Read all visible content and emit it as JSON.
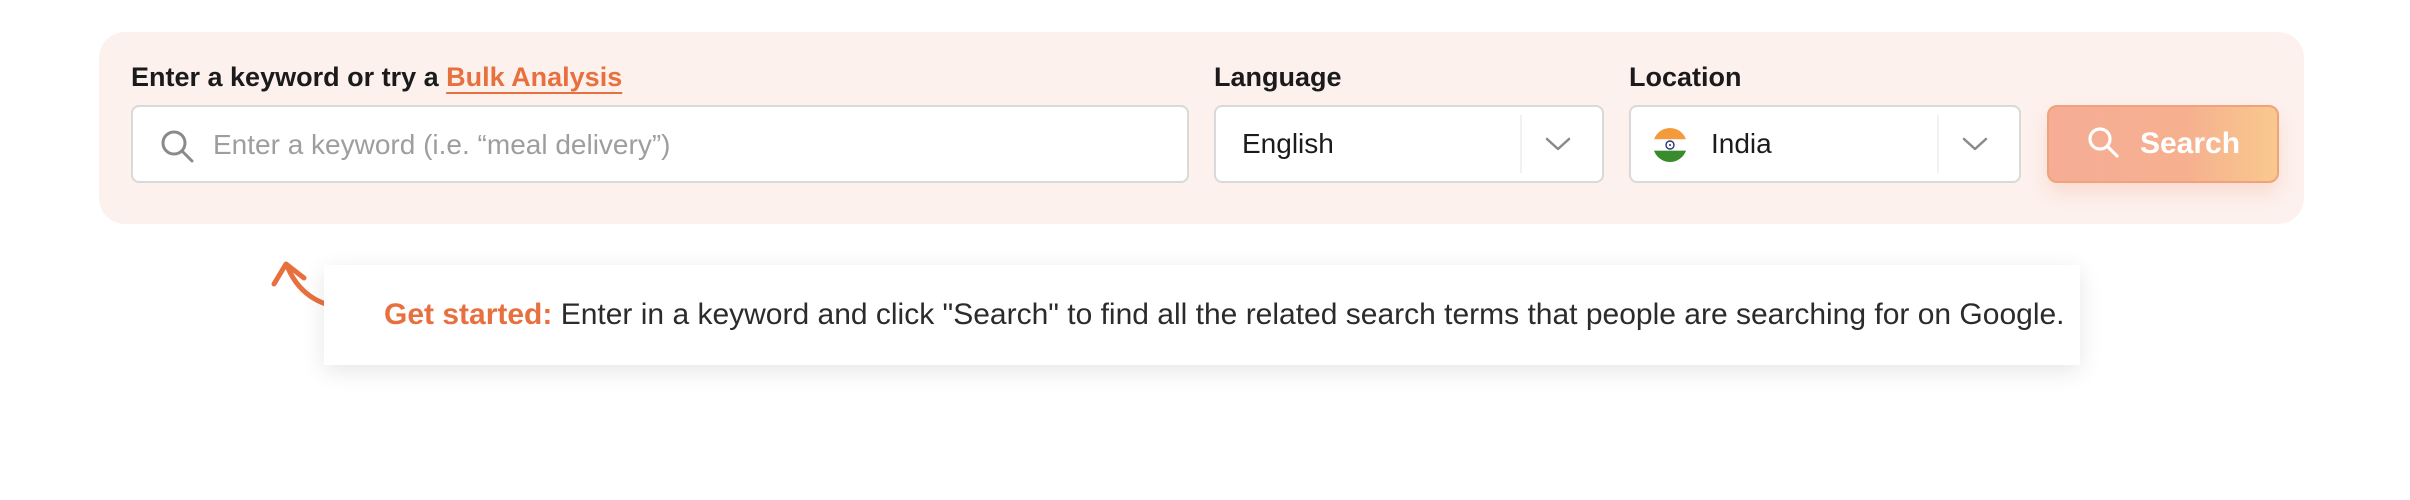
{
  "search_panel": {
    "keyword_label_prefix": "Enter a keyword or try a",
    "bulk_analysis_link": "Bulk Analysis",
    "keyword_placeholder": "Enter a keyword (i.e. “meal delivery”)",
    "keyword_value": "",
    "language_label": "Language",
    "language_value": "English",
    "location_label": "Location",
    "location_value": "India",
    "search_button": "Search"
  },
  "tip": {
    "strong": "Get started:",
    "text": "Enter in a keyword and click \"Search\" to find all the related search terms that people are searching for on Google."
  },
  "colors": {
    "accent": "#e8703f",
    "panel_bg": "#fdf1ee",
    "button_gradient_start": "#f5ad96",
    "button_gradient_end": "#f8c98e"
  },
  "icons": {
    "keyword_field": "search-icon",
    "dropdown": "chevron-down-icon",
    "location_flag": "india-flag-icon",
    "button": "search-icon",
    "tip": "curved-arrow-icon"
  }
}
